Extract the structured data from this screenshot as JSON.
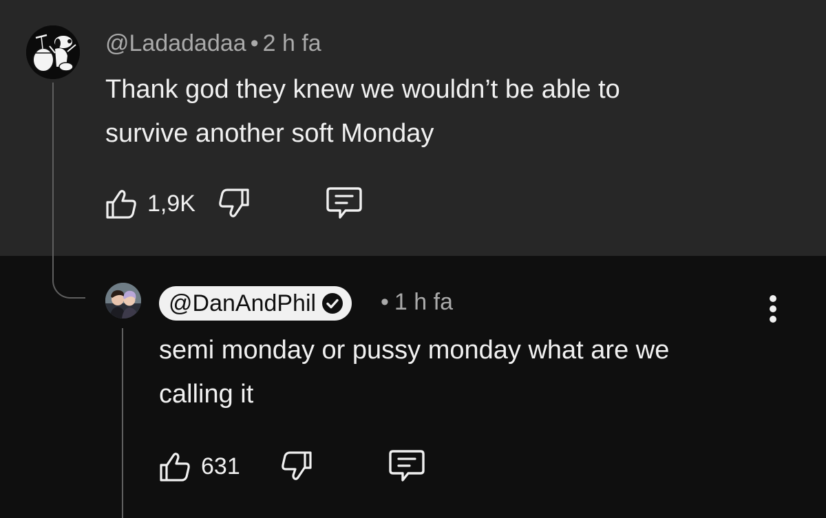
{
  "parent_comment": {
    "author": "@Ladadadaa",
    "separator": "•",
    "time": "2 h fa",
    "text_line1": "Thank god they knew we wouldn’t be able to",
    "text_line2": "survive another soft Monday",
    "like_count": "1,9K",
    "icons": [
      "avatar-snoopy-drummer",
      "thumbs-up-icon",
      "thumbs-down-icon",
      "reply-comment-icon"
    ]
  },
  "reply_comment": {
    "author": "@DanAndPhil",
    "verified": true,
    "separator": "•",
    "time": "1 h fa",
    "text_line1": "semi monday or pussy monday what are we",
    "text_line2": "calling it",
    "like_count": "631",
    "icons": [
      "avatar-two-people",
      "verified-check-icon",
      "more-vertical-icon",
      "thumbs-up-icon",
      "thumbs-down-icon",
      "reply-comment-icon"
    ]
  },
  "colors": {
    "parent_background": "#272727",
    "reply_background": "#0f0f0f",
    "text_primary": "#f1f1f1",
    "text_secondary": "#aaaaaa",
    "thread_line": "#5f5f5f",
    "author_chip": "#f1f1f1"
  }
}
